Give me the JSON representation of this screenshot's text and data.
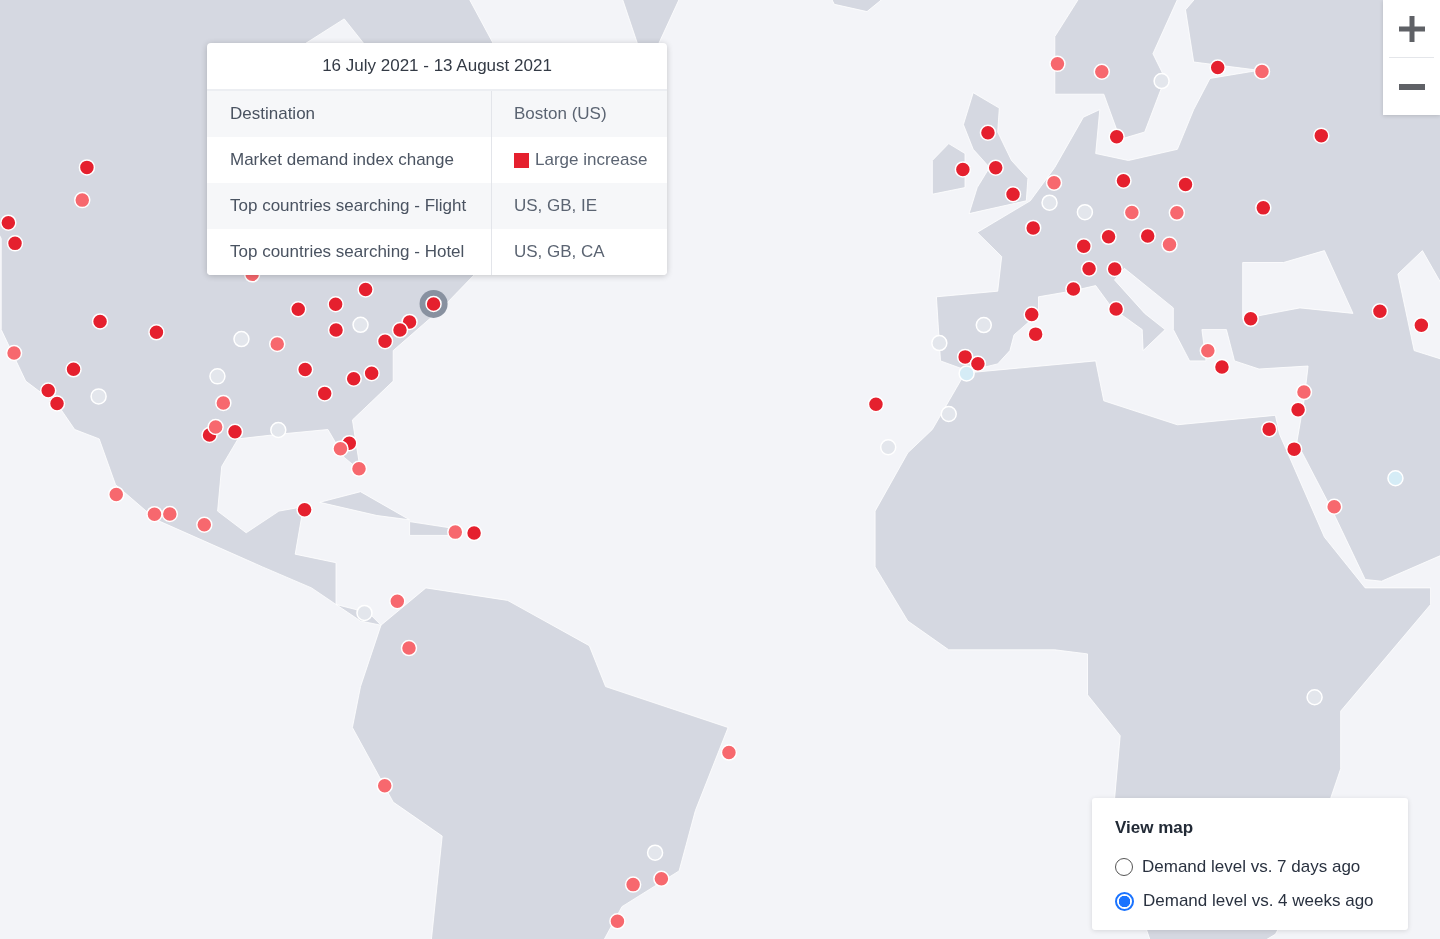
{
  "map": {
    "markers": [
      {
        "color": "#e5202e",
        "selected": true
      },
      {
        "color": "#e5202e",
        "selected": false
      },
      {
        "color": "#e5202e",
        "selected": false
      },
      {
        "color": "#e5202e",
        "selected": false
      },
      {
        "color": "#e5202e",
        "selected": false
      },
      {
        "color": "#e5202e",
        "selected": false
      },
      {
        "color": "#e5202e",
        "selected": false
      },
      {
        "color": "#f7686e",
        "selected": false
      },
      {
        "color": "#e5202e",
        "selected": false
      },
      {
        "color": "#e5202e",
        "selected": false
      },
      {
        "color": "#e5202e",
        "selected": false
      },
      {
        "color": "#e5202e",
        "selected": false
      },
      {
        "color": "#f7686e",
        "selected": false
      },
      {
        "color": "#e5202e",
        "selected": false
      },
      {
        "color": "#e5202e",
        "selected": false
      },
      {
        "color": "#e5202e",
        "selected": false
      },
      {
        "color": "#e3e6ec",
        "selected": false
      },
      {
        "color": "#f7686e",
        "selected": false
      },
      {
        "color": "#e5202e",
        "selected": false
      },
      {
        "color": "#e5202e",
        "selected": false
      },
      {
        "color": "#f7686e",
        "selected": false
      },
      {
        "color": "#e5202e",
        "selected": false
      },
      {
        "color": "#e5202e",
        "selected": false
      },
      {
        "color": "#e5202e",
        "selected": false
      },
      {
        "color": "#e5202e",
        "selected": false
      },
      {
        "color": "#f7686e",
        "selected": false
      },
      {
        "color": "#f7686e",
        "selected": false
      },
      {
        "color": "#e3e6ec",
        "selected": false
      },
      {
        "color": "#f7686e",
        "selected": false
      },
      {
        "color": "#e3e6ec",
        "selected": false
      },
      {
        "color": "#e3e6ec",
        "selected": false
      },
      {
        "color": "#e5202e",
        "selected": false
      },
      {
        "color": "#e3e6ec",
        "selected": false
      },
      {
        "color": "#e5202e",
        "selected": false
      },
      {
        "color": "#f7686e",
        "selected": false
      },
      {
        "color": "#e5202e",
        "selected": false
      },
      {
        "color": "#f7686e",
        "selected": false
      },
      {
        "color": "#e5202e",
        "selected": false
      },
      {
        "color": "#f7686e",
        "selected": false
      },
      {
        "color": "#f7686e",
        "selected": false
      },
      {
        "color": "#f7686e",
        "selected": false
      },
      {
        "color": "#e5202e",
        "selected": false
      },
      {
        "color": "#f7686e",
        "selected": false
      },
      {
        "color": "#f7686e",
        "selected": false
      },
      {
        "color": "#f7686e",
        "selected": false
      },
      {
        "color": "#e3e6ec",
        "selected": false
      },
      {
        "color": "#f7686e",
        "selected": false
      },
      {
        "color": "#f7686e",
        "selected": false
      },
      {
        "color": "#f7686e",
        "selected": false
      },
      {
        "color": "#f7686e",
        "selected": false
      },
      {
        "color": "#f7686e",
        "selected": false
      },
      {
        "color": "#e3e6ec",
        "selected": false
      },
      {
        "color": "#e5202e",
        "selected": false
      },
      {
        "color": "#e5202e",
        "selected": false
      },
      {
        "color": "#e5202e",
        "selected": false
      },
      {
        "color": "#e5202e",
        "selected": false
      },
      {
        "color": "#e5202e",
        "selected": false
      },
      {
        "color": "#e5202e",
        "selected": false
      },
      {
        "color": "#e5202e",
        "selected": false
      },
      {
        "color": "#e3e6ec",
        "selected": false
      },
      {
        "color": "#e3e6ec",
        "selected": false
      },
      {
        "color": "#e5202e",
        "selected": false
      },
      {
        "color": "#e5202e",
        "selected": false
      },
      {
        "color": "#e5202e",
        "selected": false
      },
      {
        "color": "#e5202e",
        "selected": false
      },
      {
        "color": "#e5202e",
        "selected": false
      },
      {
        "color": "#e5202e",
        "selected": false
      },
      {
        "color": "#f7686e",
        "selected": false
      },
      {
        "color": "#e3e6ec",
        "selected": false
      },
      {
        "color": "#e5202e",
        "selected": false
      },
      {
        "color": "#e5202e",
        "selected": false
      },
      {
        "color": "#e3e6ec",
        "selected": false
      },
      {
        "color": "#e5202e",
        "selected": false
      },
      {
        "color": "#f7686e",
        "selected": false
      },
      {
        "color": "#e5202e",
        "selected": false
      },
      {
        "color": "#e5202e",
        "selected": false
      },
      {
        "color": "#e3e6ec",
        "selected": false
      },
      {
        "color": "#f7686e",
        "selected": false
      },
      {
        "color": "#f7686e",
        "selected": false
      },
      {
        "color": "#e5202e",
        "selected": false
      },
      {
        "color": "#e5202e",
        "selected": false
      },
      {
        "color": "#f7686e",
        "selected": false
      },
      {
        "color": "#f7686e",
        "selected": false
      },
      {
        "color": "#f7686e",
        "selected": false
      },
      {
        "color": "#e5202e",
        "selected": false
      },
      {
        "color": "#e5202e",
        "selected": false
      },
      {
        "color": "#e5202e",
        "selected": false
      },
      {
        "color": "#f7686e",
        "selected": false
      },
      {
        "color": "#e5202e",
        "selected": false
      },
      {
        "color": "#e5202e",
        "selected": false
      },
      {
        "color": "#e5202e",
        "selected": false
      },
      {
        "color": "#e5202e",
        "selected": false
      },
      {
        "color": "#f7686e",
        "selected": false
      },
      {
        "color": "#e5202e",
        "selected": false
      },
      {
        "color": "#e5202e",
        "selected": false
      },
      {
        "color": "#f7686e",
        "selected": false
      },
      {
        "color": "#d5ecf6",
        "selected": false
      },
      {
        "color": "#e3e6ec",
        "selected": false
      },
      {
        "color": "#d5ecf6",
        "selected": false
      },
      {
        "color": "#e5202e",
        "selected": false
      },
      {
        "color": "#e3e6ec",
        "selected": false
      },
      {
        "color": "#e3e6ec",
        "selected": false
      }
    ]
  },
  "tooltip": {
    "date_range": "16 July 2021 - 13 August 2021",
    "rows": [
      {
        "label": "Destination",
        "value": "Boston (US)"
      },
      {
        "label": "Market demand index change",
        "value": "Large increase",
        "color": "#e5202e"
      },
      {
        "label": "Top countries searching - Flight",
        "value": "US, GB, IE"
      },
      {
        "label": "Top countries searching - Hotel",
        "value": "US, GB, CA"
      }
    ]
  },
  "view_map": {
    "title": "View map",
    "options": [
      {
        "label": "Demand level vs. 7 days ago",
        "selected": false
      },
      {
        "label": "Demand level vs. 4 weeks ago",
        "selected": true
      }
    ]
  }
}
